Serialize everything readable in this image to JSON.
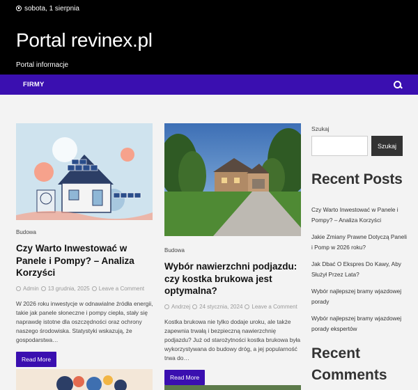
{
  "topbar": {
    "date": "sobota, 1 sierpnia"
  },
  "header": {
    "site_title": "Portal revinex.pl",
    "site_description": "Portal informacje"
  },
  "nav": {
    "items": [
      {
        "label": "FIRMY"
      }
    ]
  },
  "posts": [
    {
      "category": "Budowa",
      "title": "Czy Warto Inwestować w Panele i Pompy? – Analiza Korzyści",
      "author": "Admin",
      "date": "13 grudnia, 2025",
      "comments": "Leave a Comment",
      "excerpt": "W 2026 roku inwestycje w odnawialne źródła energii, takie jak panele słoneczne i pompy ciepła, stały się naprawdę istotne dla oszczędności oraz ochrony naszego środowiska. Statystyki wskazują, że gospodarstwa…",
      "button": "Read More"
    },
    {
      "category": "Budowa",
      "title": "Wybór nawierzchni podjazdu: czy kostka brukowa jest optymalna?",
      "author": "Andrzej",
      "date": "24 stycznia, 2024",
      "comments": "Leave a Comment",
      "excerpt": "Kostka brukowa nie tylko dodaje uroku, ale także zapewnia trwałą i bezpieczną nawierzchnię podjazdu? Już od starożytności kostka brukowa była wykorzystywana do budowy dróg, a jej popularność trwa do…",
      "button": "Read More"
    }
  ],
  "sidebar": {
    "search_label": "Szukaj",
    "search_placeholder": "",
    "search_button": "Szukaj",
    "recent_posts_title": "Recent Posts",
    "recent_posts": [
      "Czy Warto Inwestować w Panele i Pompy? – Analiza Korzyści",
      "Jakie Zmiany Prawne Dotyczą Paneli i Pomp w 2026 roku?",
      "Jak Dbać O Ekspres Do Kawy, Aby Służył Przez Lata?",
      "Wybór najlepszej bramy wjazdowej porady",
      "Wybór najlepszej bramy wjazdowej porady ekspertów"
    ],
    "recent_comments_title": "Recent Comments"
  },
  "colors": {
    "nav_bg": "#3a0fb0",
    "header_bg": "#000000",
    "button_bg": "#3a0fb0"
  }
}
